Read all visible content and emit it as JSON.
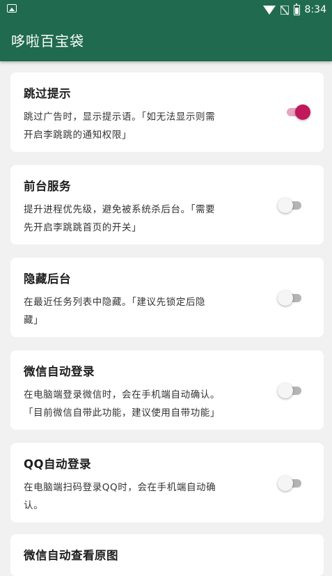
{
  "status_bar": {
    "time": "8:34",
    "icons": [
      "gallery-icon",
      "wifi-icon",
      "no-signal-icon",
      "battery-charging-icon"
    ]
  },
  "app_bar": {
    "title": "哆啦百宝袋"
  },
  "accent_color": "#c2185b",
  "primary_color": "#206b4f",
  "settings": [
    {
      "title": "跳过提示",
      "desc_lines": [
        "跳过广告时，显示提示语。「如无法显示则需",
        "开启李跳跳的通知权限」"
      ],
      "enabled": true
    },
    {
      "title": "前台服务",
      "desc_lines": [
        "提升进程优先级，避免被系统杀后台。「需要",
        "先开启李跳跳首页的开关」"
      ],
      "enabled": false
    },
    {
      "title": "隐藏后台",
      "desc_lines": [
        "在最近任务列表中隐藏。「建议先锁定后隐",
        "藏」"
      ],
      "enabled": false
    },
    {
      "title": "微信自动登录",
      "desc_lines": [
        "在电脑端登录微信时，会在手机端自动确认。",
        "「目前微信自带此功能，建议使用自带功能」"
      ],
      "enabled": false
    },
    {
      "title": "QQ自动登录",
      "desc_lines": [
        "在电脑端扫码登录QQ时，会在手机端自动确",
        "认。"
      ],
      "enabled": false
    },
    {
      "title": "微信自动查看原图",
      "desc_lines": [],
      "enabled": false
    }
  ]
}
